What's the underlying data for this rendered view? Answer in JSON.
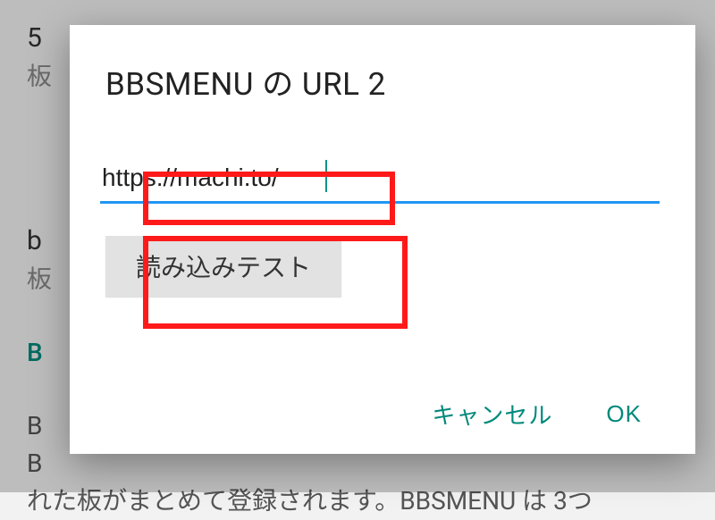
{
  "background": {
    "line1": "5",
    "line2": "板",
    "lineB1": "b",
    "lineB2": "板",
    "tealB": "B",
    "body1": "B",
    "body2": "B",
    "body3": "れた板がまとめて登録されます。BBSMENU は 3つ"
  },
  "dialog": {
    "title": "BBSMENU の URL 2",
    "url_value": "https://machi.to/",
    "test_button": "読み込みテスト",
    "cancel": "キャンセル",
    "ok": "OK"
  }
}
